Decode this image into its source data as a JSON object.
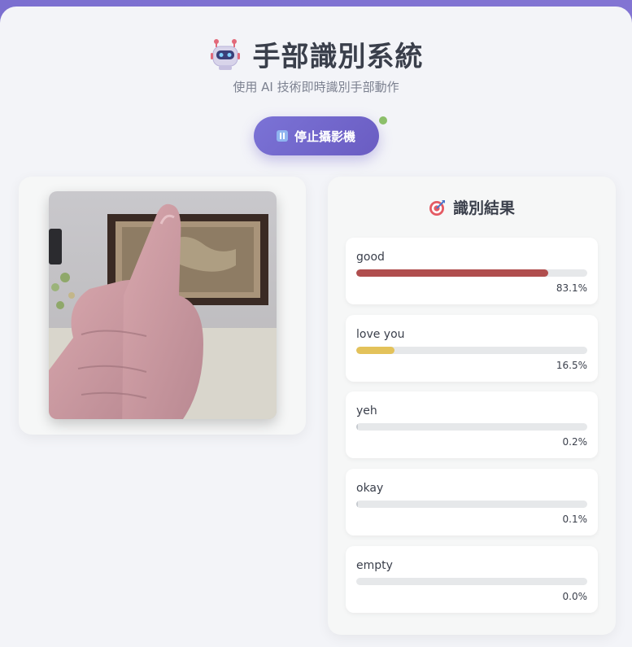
{
  "header": {
    "title": "手部識別系統",
    "subtitle": "使用 AI 技術即時識別手部動作",
    "icon": "robot-icon"
  },
  "controls": {
    "stop_camera_label": "停止攝影機",
    "button_icon": "pause-icon",
    "status_color": "#8cbf6a"
  },
  "results": {
    "title": "識別結果",
    "icon": "target-icon",
    "items": [
      {
        "label": "good",
        "percent": "83.1%",
        "value": 0.831,
        "color": "#b04e4e"
      },
      {
        "label": "love you",
        "percent": "16.5%",
        "value": 0.165,
        "color": "#e3c25a"
      },
      {
        "label": "yeh",
        "percent": "0.2%",
        "value": 0.002,
        "color": "#c7cbd0"
      },
      {
        "label": "okay",
        "percent": "0.1%",
        "value": 0.001,
        "color": "#c7cbd0"
      },
      {
        "label": "empty",
        "percent": "0.0%",
        "value": 0.0,
        "color": "#c7cbd0"
      }
    ]
  },
  "colors": {
    "accent": "#6a5cc2",
    "background": "#f3f4f8"
  }
}
